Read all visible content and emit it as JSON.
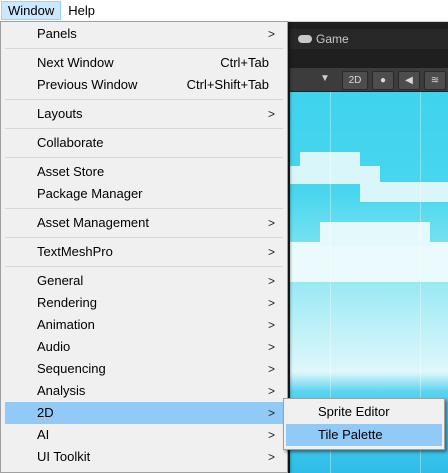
{
  "menubar": {
    "items": [
      {
        "label": "Window",
        "active": true
      },
      {
        "label": "Help",
        "active": false
      }
    ]
  },
  "game_view": {
    "tab_label": "Game",
    "tab_icon": "gamepad-icon",
    "toolbar": {
      "mode_2d": "2D",
      "icons": [
        "light-icon",
        "audio-icon",
        "effects-icon"
      ]
    }
  },
  "window_menu": {
    "panels": "Panels",
    "next_window": {
      "label": "Next Window",
      "shortcut": "Ctrl+Tab"
    },
    "previous_window": {
      "label": "Previous Window",
      "shortcut": "Ctrl+Shift+Tab"
    },
    "layouts": "Layouts",
    "collaborate": "Collaborate",
    "asset_store": "Asset Store",
    "package_manager": "Package Manager",
    "asset_management": "Asset Management",
    "textmeshpro": "TextMeshPro",
    "general": "General",
    "rendering": "Rendering",
    "animation": "Animation",
    "audio": "Audio",
    "sequencing": "Sequencing",
    "analysis": "Analysis",
    "twod": "2D",
    "ai": "AI",
    "ui_toolkit": "UI Toolkit"
  },
  "submenu_2d": {
    "sprite_editor": "Sprite Editor",
    "tile_palette": "Tile Palette"
  },
  "colors": {
    "highlight": "#91c9f7",
    "menu_bg": "#f0f0f0",
    "active_menubar": "#cce8ff"
  }
}
